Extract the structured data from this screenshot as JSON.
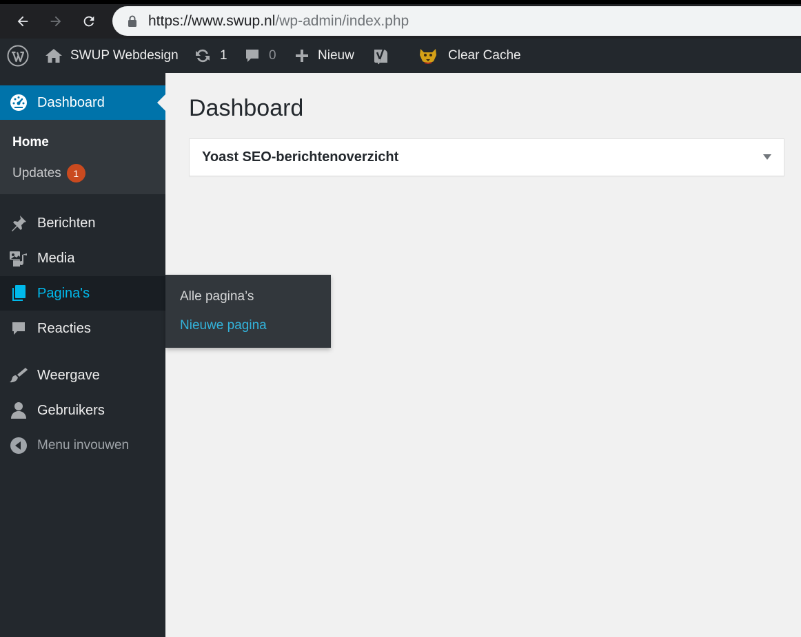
{
  "browser": {
    "url_host": "https://www.swup.nl",
    "url_path": "/wp-admin/index.php"
  },
  "adminbar": {
    "site_name": "SWUP Webdesign",
    "updates_count": "1",
    "comments_count": "0",
    "new_label": "Nieuw",
    "clear_cache_label": "Clear Cache"
  },
  "sidebar": {
    "dashboard": "Dashboard",
    "sub_home": "Home",
    "sub_updates": "Updates",
    "updates_badge": "1",
    "items": [
      {
        "label": "Berichten"
      },
      {
        "label": "Media"
      },
      {
        "label": "Pagina's"
      },
      {
        "label": "Reacties"
      },
      {
        "label": "Weergave"
      },
      {
        "label": "Gebruikers"
      }
    ],
    "collapse": "Menu invouwen"
  },
  "flyout": {
    "all_pages": "Alle pagina’s",
    "new_page": "Nieuwe pagina"
  },
  "main": {
    "title": "Dashboard",
    "widget_title": "Yoast SEO-berichtenoverzicht"
  },
  "colors": {
    "adminbar_bg": "#23282d",
    "active_blue": "#0073aa",
    "link_blue": "#00b9eb",
    "badge_orange": "#ca4a1f"
  }
}
